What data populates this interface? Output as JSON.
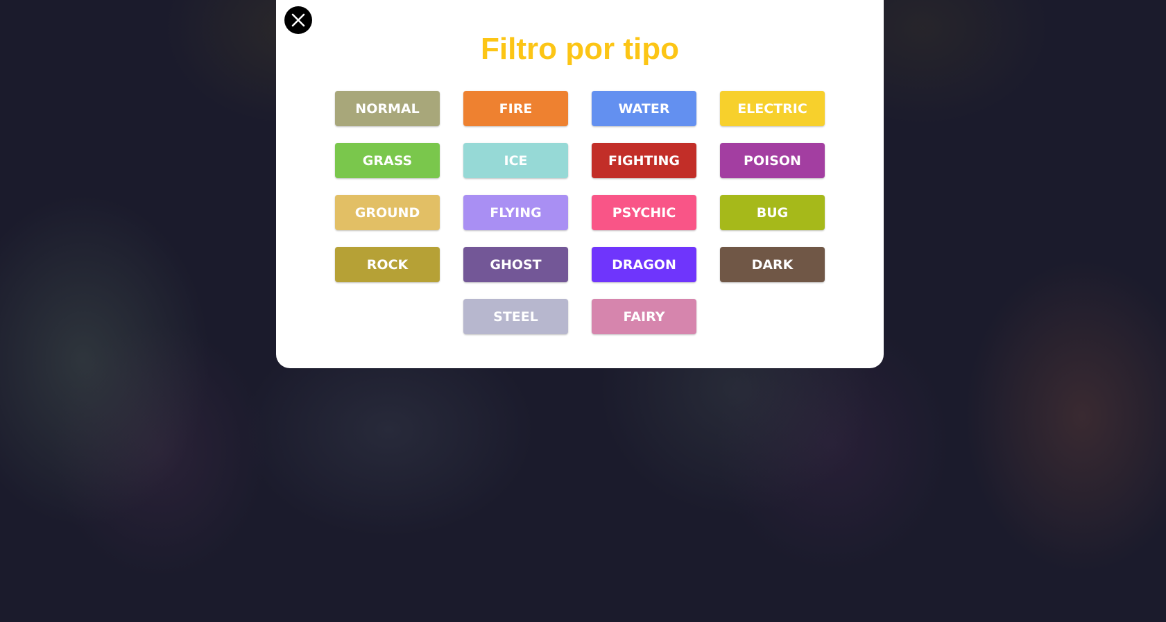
{
  "modal": {
    "title": "Filtro por tipo",
    "close_icon": "close-icon"
  },
  "types": [
    {
      "label": "NORMAL",
      "color": "#a8a77a"
    },
    {
      "label": "FIRE",
      "color": "#ee8130"
    },
    {
      "label": "WATER",
      "color": "#6390f0"
    },
    {
      "label": "ELECTRIC",
      "color": "#f7d02c"
    },
    {
      "label": "GRASS",
      "color": "#7ac74c"
    },
    {
      "label": "ICE",
      "color": "#96d9d6"
    },
    {
      "label": "FIGHTING",
      "color": "#c22e28"
    },
    {
      "label": "POISON",
      "color": "#a33ea1"
    },
    {
      "label": "GROUND",
      "color": "#e2bf65"
    },
    {
      "label": "FLYING",
      "color": "#a98ff3"
    },
    {
      "label": "PSYCHIC",
      "color": "#f95587"
    },
    {
      "label": "BUG",
      "color": "#a6b91a"
    },
    {
      "label": "ROCK",
      "color": "#b6a136"
    },
    {
      "label": "GHOST",
      "color": "#735797"
    },
    {
      "label": "DRAGON",
      "color": "#6f35fc"
    },
    {
      "label": "DARK",
      "color": "#705746"
    },
    {
      "label": "STEEL",
      "color": "#b7b7ce"
    },
    {
      "label": "FAIRY",
      "color": "#d685ad"
    }
  ]
}
